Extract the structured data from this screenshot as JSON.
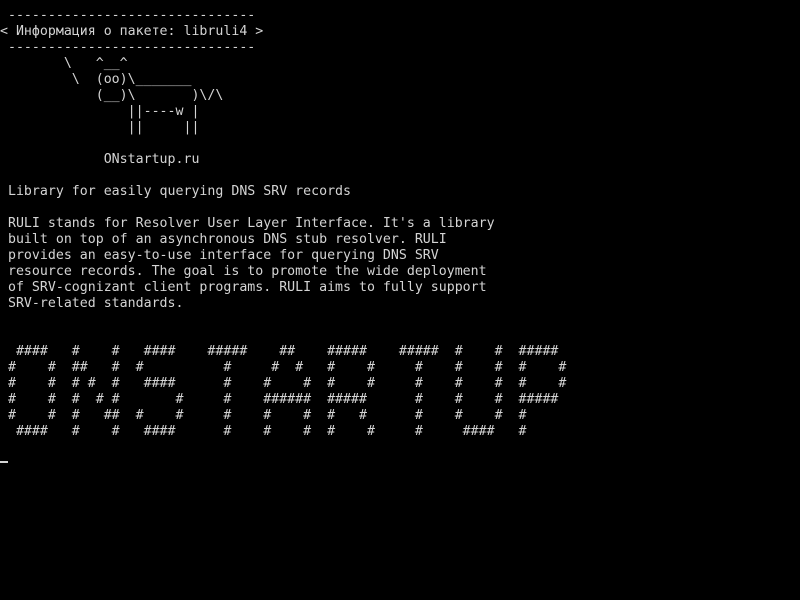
{
  "screen": {
    "background": "#000000",
    "text_color": "#d4d4d4"
  },
  "terminal": {
    "lines": [
      " -------------------------------",
      "< Информация о пакете: libruli4 >",
      " -------------------------------",
      "        \\   ^__^",
      "         \\  (oo)\\_______",
      "            (__)\\       )\\/\\",
      "                ||----w |",
      "                ||     ||",
      "",
      "             ONstartup.ru",
      "",
      " Library for easily querying DNS SRV records",
      "",
      " RULI stands for Resolver User Layer Interface. It's a library",
      " built on top of an asynchronous DNS stub resolver. RULI",
      " provides an easy-to-use interface for querying DNS SRV",
      " resource records. The goal is to promote the wide deployment",
      " of SRV-cognizant client programs. RULI aims to fully support",
      " SRV-related standards.",
      "",
      "",
      "  ####   #    #   ####    #####    ##    #####    #####  #    #  #####",
      " #    #  ##   #  #          #     #  #   #    #     #    #    #  #    #",
      " #    #  # #  #   ####      #    #    #  #    #     #    #    #  #    #",
      " #    #  #  # #       #     #    ######  #####      #    #    #  #####",
      " #    #  #   ##  #    #     #    #    #  #   #      #    #    #  #",
      "  ####   #    #   ####      #    #    #  #    #     #     ####   #"
    ]
  }
}
